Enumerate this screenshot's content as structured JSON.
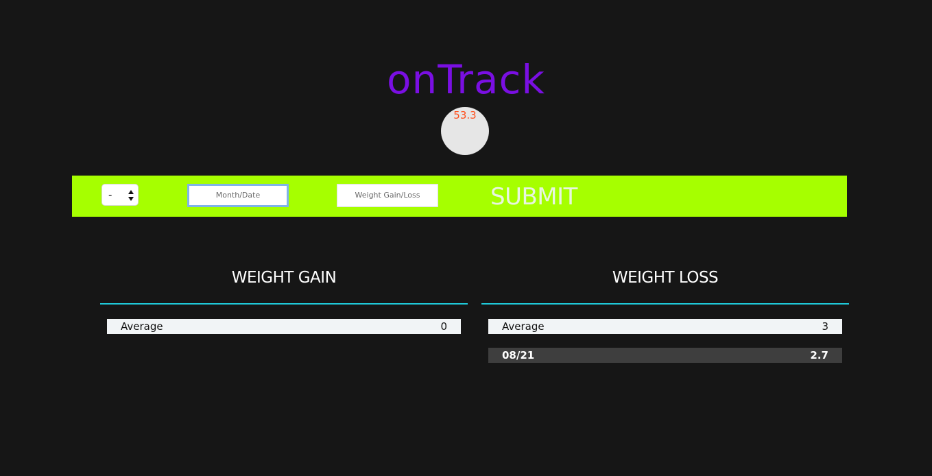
{
  "app": {
    "title": "onTrack",
    "indicator_value": "53.3"
  },
  "form": {
    "sign_select": {
      "selected": "-"
    },
    "date_input": {
      "placeholder": "Month/Date",
      "value": ""
    },
    "weight_input": {
      "placeholder": "Weight Gain/Loss",
      "value": ""
    },
    "submit_label": "SUBMIT"
  },
  "gain": {
    "title": "WEIGHT GAIN",
    "average": {
      "label": "Average",
      "value": "0"
    },
    "entries": []
  },
  "loss": {
    "title": "WEIGHT LOSS",
    "average": {
      "label": "Average",
      "value": "3"
    },
    "entries": [
      {
        "date": "08/21",
        "value": "2.7"
      }
    ]
  },
  "colors": {
    "background": "#161616",
    "title": "#7a0fe3",
    "indicator_text": "#ff4d1a",
    "form_bar": "#a6ff00",
    "divider": "#1fc8d8"
  }
}
